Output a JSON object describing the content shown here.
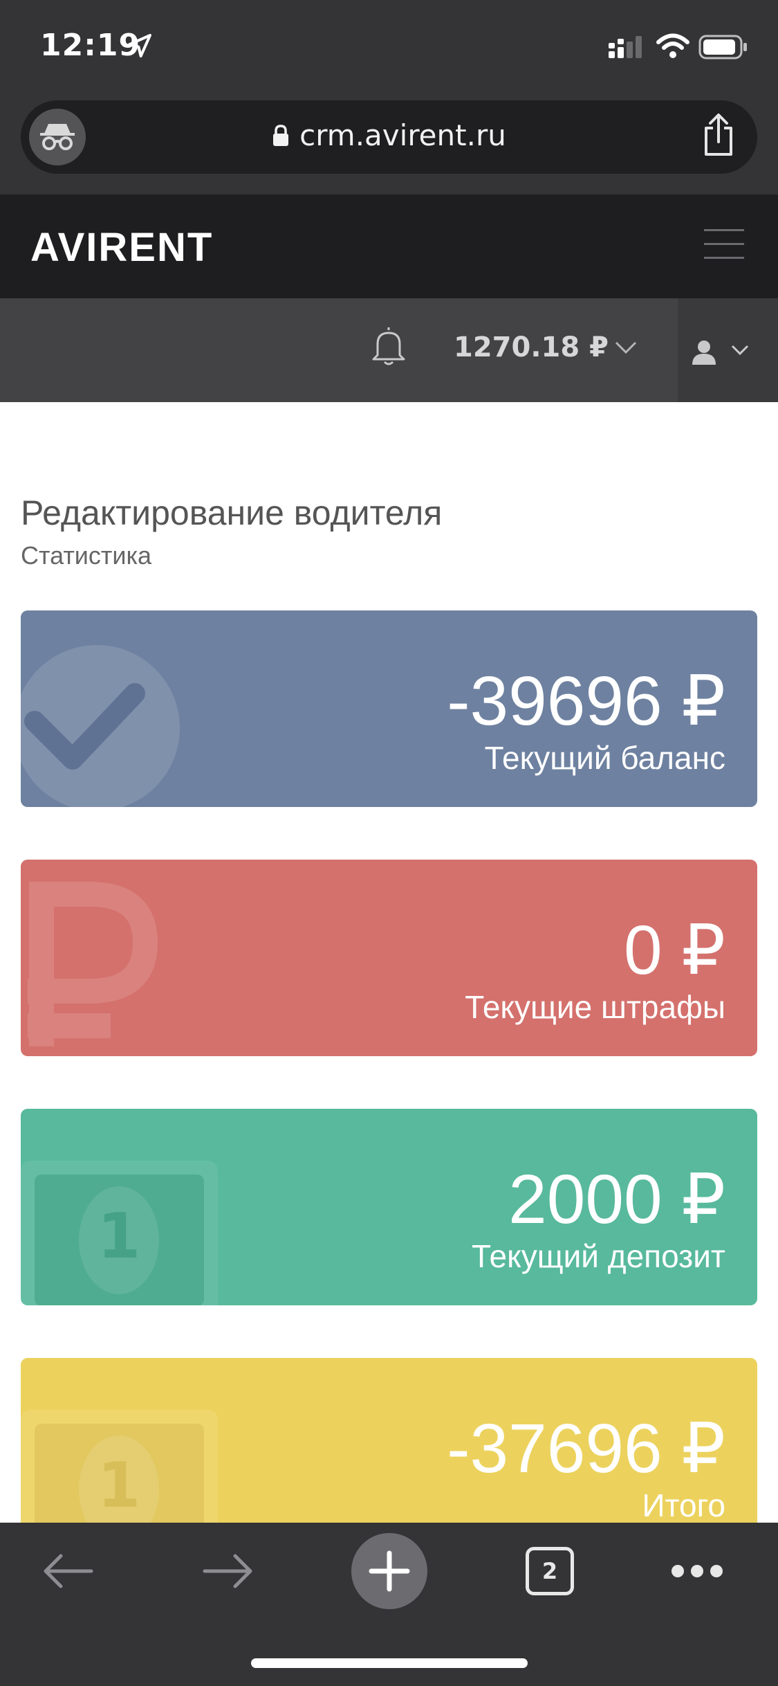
{
  "status_bar": {
    "time": "12:19"
  },
  "browser": {
    "url": "crm.avirent.ru",
    "tab_count": "2"
  },
  "site": {
    "logo": "AVIRENT",
    "account_balance": "1270.18 ₽"
  },
  "page": {
    "title": "Редактирование водителя",
    "subtitle": "Статистика"
  },
  "cards": [
    {
      "amount": "-39696 ₽",
      "label": "Текущий баланс",
      "color": "#6e81a0",
      "icon": "check-circle-icon"
    },
    {
      "amount": "0 ₽",
      "label": "Текущие штрафы",
      "color": "#d4716d",
      "icon": "ruble-icon"
    },
    {
      "amount": "2000 ₽",
      "label": "Текущий депозит",
      "color": "#58b99c",
      "icon": "banknote-icon"
    },
    {
      "amount": "-37696 ₽",
      "label": "Итого",
      "color": "#ecd25d",
      "icon": "banknote-icon"
    }
  ]
}
